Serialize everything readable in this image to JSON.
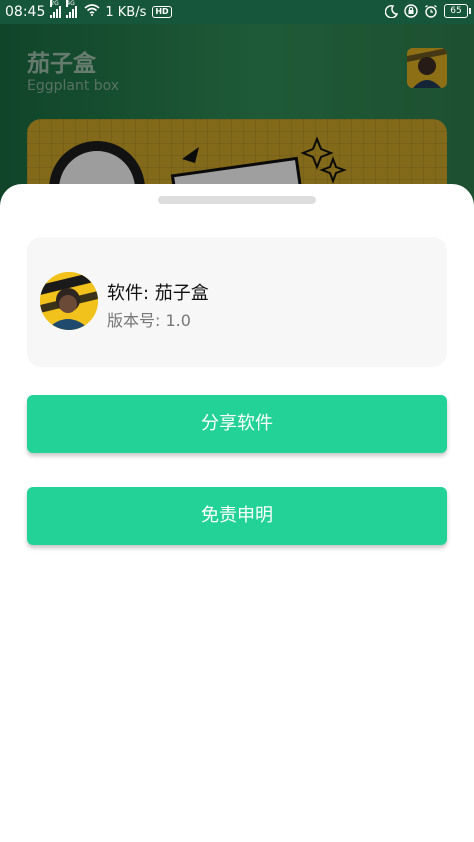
{
  "status_bar": {
    "time": "08:45",
    "network_1": "2G",
    "network_2": "4G",
    "speed": "1 KB/s",
    "hd": "HD",
    "battery": "65"
  },
  "background": {
    "title": "茄子盒",
    "subtitle": "Eggplant box"
  },
  "sheet": {
    "app_name": "软件: 茄子盒",
    "version": "版本号: 1.0",
    "share_button": "分享软件",
    "disclaimer_button": "免责申明"
  },
  "colors": {
    "accent": "#23d297",
    "status_bar": "#16563a"
  }
}
